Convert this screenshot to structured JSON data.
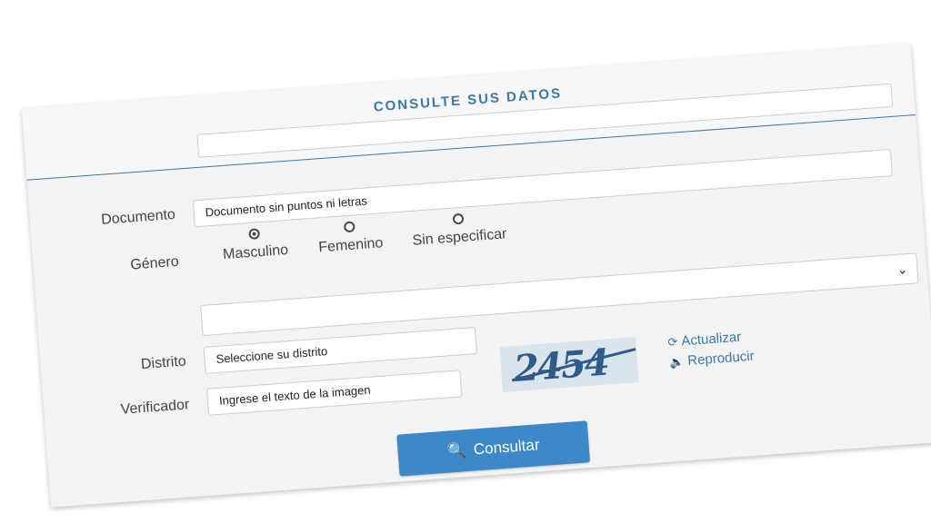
{
  "form": {
    "title": "CONSULTE SUS DATOS",
    "labels": {
      "documento": "Documento",
      "genero": "Género",
      "distrito": "Distrito",
      "verificador": "Verificador"
    },
    "documento_placeholder": "Documento sin puntos ni letras",
    "genero_options": [
      {
        "label": "Masculino",
        "checked": true
      },
      {
        "label": "Femenino",
        "checked": false
      },
      {
        "label": "Sin especificar",
        "checked": false
      }
    ],
    "distrito_placeholder": "Seleccione su distrito",
    "verificador_placeholder": "Ingrese el texto de la imagen",
    "captcha_text": "2454",
    "links": {
      "actualizar": "Actualizar",
      "reproducir": "Reproducir"
    },
    "button_label": "Consultar",
    "icons": {
      "refresh": "refresh-icon",
      "audio": "audio-icon",
      "search": "search-icon",
      "chevron": "chevron-down-icon"
    },
    "colors": {
      "accent": "#3b78a8",
      "button": "#3c88c8",
      "card_bg": "#f3f3f3"
    }
  }
}
